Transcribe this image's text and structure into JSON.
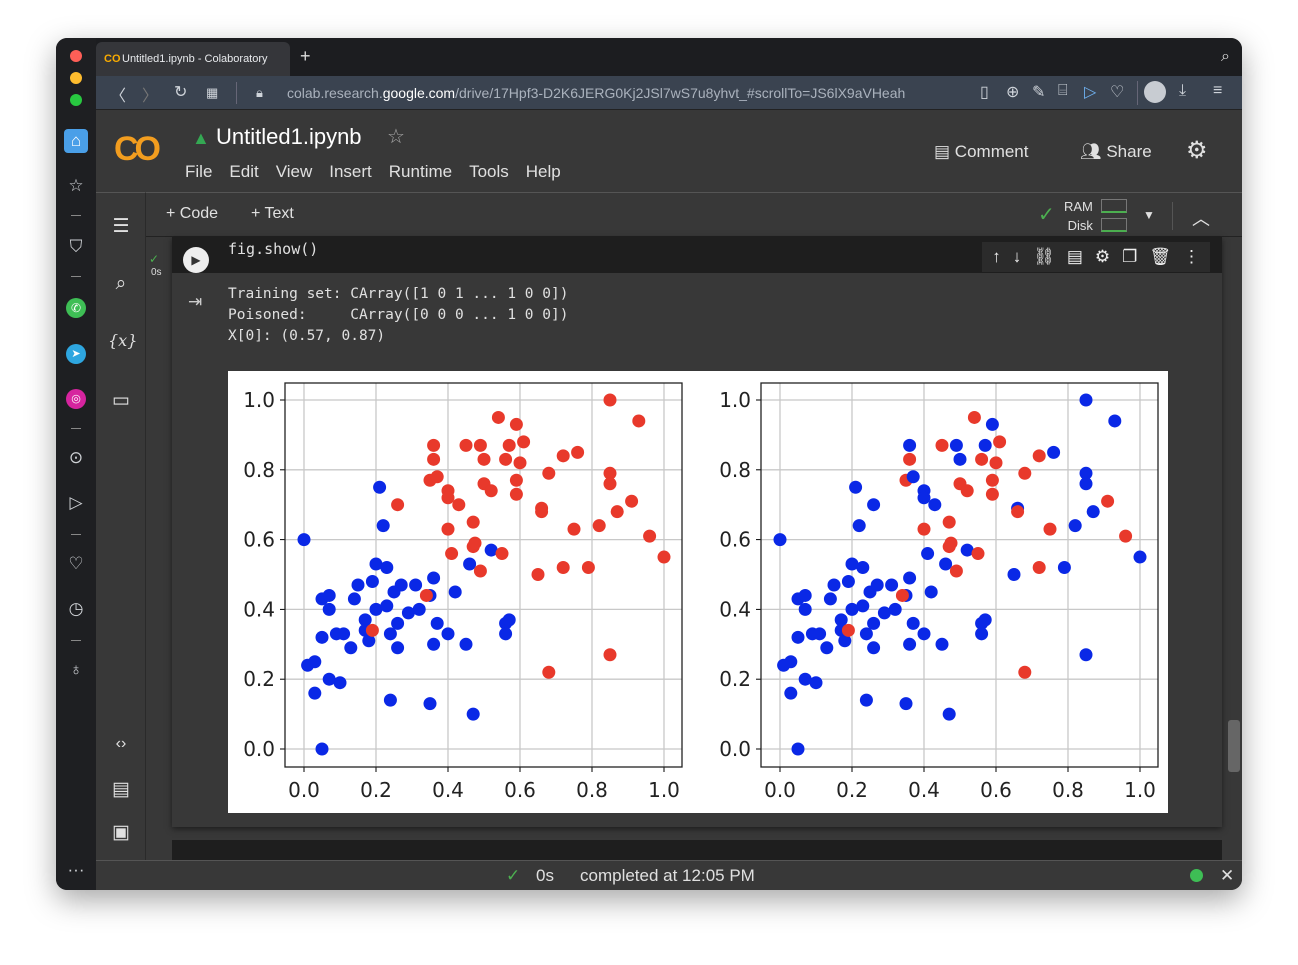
{
  "browser": {
    "tab_title": "Untitled1.ipynb - Colaboratory",
    "url_prefix": "colab.research.",
    "url_domain": "google.com",
    "url_path": "/drive/17Hpf3-D2K6JERG0Kj2JSl7wS7u8yhvt_#scrollTo=JS6lX9aVHeah",
    "new_tab": "+"
  },
  "colab": {
    "logo": "CO",
    "title": "Untitled1.ipynb",
    "menu": [
      "File",
      "Edit",
      "View",
      "Insert",
      "Runtime",
      "Tools",
      "Help"
    ],
    "comment": "Comment",
    "share": "Share",
    "add_code": "+ Code",
    "add_text": "+ Text",
    "ram": "RAM",
    "disk": "Disk"
  },
  "cell": {
    "code": "fig.show()",
    "exec_time": "0s",
    "output": [
      "Training set: CArray([1 0 1 ... 1 0 0])",
      "Poisoned:     CArray([0 0 0 ... 1 0 0])",
      "X[0]: (0.57, 0.87)"
    ]
  },
  "status": {
    "time": "0s",
    "message": "completed at 12:05 PM"
  },
  "colors": {
    "red": "#e8392b",
    "blue": "#0a28e6"
  },
  "chart_data": [
    {
      "type": "scatter",
      "title": "Training set",
      "xlim": [
        -0.05,
        1.05
      ],
      "ylim": [
        -0.07,
        1.07
      ],
      "xticks": [
        "0.0",
        "0.2",
        "0.4",
        "0.6",
        "0.8",
        "1.0"
      ],
      "yticks": [
        "0.0",
        "0.2",
        "0.4",
        "0.6",
        "0.8",
        "1.0"
      ],
      "grid": true,
      "label_key": 2
    },
    {
      "type": "scatter",
      "title": "Poisoned",
      "xlim": [
        -0.05,
        1.05
      ],
      "ylim": [
        -0.07,
        1.07
      ],
      "xticks": [
        "0.0",
        "0.2",
        "0.4",
        "0.6",
        "0.8",
        "1.0"
      ],
      "yticks": [
        "0.0",
        "0.2",
        "0.4",
        "0.6",
        "0.8",
        "1.0"
      ],
      "grid": true,
      "label_key": 3
    }
  ],
  "points_columns": [
    "x",
    "y",
    "train_label",
    "poisoned_label"
  ],
  "points": [
    [
      0,
      0.6,
      0,
      0
    ],
    [
      0.21,
      0.75,
      0,
      0
    ],
    [
      0.22,
      0.64,
      0,
      0
    ],
    [
      0.2,
      0.53,
      0,
      0
    ],
    [
      0.23,
      0.52,
      0,
      0
    ],
    [
      0.19,
      0.48,
      0,
      0
    ],
    [
      0.15,
      0.47,
      0,
      0
    ],
    [
      0.14,
      0.43,
      0,
      0
    ],
    [
      0.05,
      0.43,
      0,
      0
    ],
    [
      0.07,
      0.44,
      0,
      0
    ],
    [
      0.07,
      0.4,
      0,
      0
    ],
    [
      0.2,
      0.4,
      0,
      0
    ],
    [
      0.23,
      0.41,
      0,
      0
    ],
    [
      0.25,
      0.45,
      0,
      0
    ],
    [
      0.27,
      0.47,
      0,
      0
    ],
    [
      0.31,
      0.47,
      0,
      0
    ],
    [
      0.36,
      0.49,
      0,
      0
    ],
    [
      0.35,
      0.44,
      0,
      0
    ],
    [
      0.32,
      0.4,
      0,
      0
    ],
    [
      0.29,
      0.39,
      0,
      0
    ],
    [
      0.26,
      0.36,
      0,
      0
    ],
    [
      0.17,
      0.37,
      0,
      0
    ],
    [
      0.17,
      0.34,
      0,
      0
    ],
    [
      0.18,
      0.31,
      0,
      0
    ],
    [
      0.24,
      0.33,
      0,
      0
    ],
    [
      0.26,
      0.29,
      0,
      0
    ],
    [
      0.37,
      0.36,
      0,
      0
    ],
    [
      0.4,
      0.33,
      0,
      0
    ],
    [
      0.36,
      0.3,
      0,
      0
    ],
    [
      0.45,
      0.3,
      0,
      0
    ],
    [
      0.42,
      0.45,
      0,
      0
    ],
    [
      0.46,
      0.53,
      0,
      0
    ],
    [
      0.52,
      0.57,
      0,
      0
    ],
    [
      0.56,
      0.36,
      0,
      0
    ],
    [
      0.57,
      0.37,
      0,
      0
    ],
    [
      0.56,
      0.33,
      0,
      0
    ],
    [
      0.09,
      0.33,
      0,
      0
    ],
    [
      0.11,
      0.33,
      0,
      0
    ],
    [
      0.13,
      0.29,
      0,
      0
    ],
    [
      0.05,
      0.32,
      0,
      0
    ],
    [
      0.01,
      0.24,
      0,
      0
    ],
    [
      0.03,
      0.25,
      0,
      0
    ],
    [
      0.07,
      0.2,
      0,
      0
    ],
    [
      0.1,
      0.19,
      0,
      0
    ],
    [
      0.03,
      0.16,
      0,
      0
    ],
    [
      0.24,
      0.14,
      0,
      0
    ],
    [
      0.35,
      0.13,
      0,
      0
    ],
    [
      0.47,
      0.1,
      0,
      0
    ],
    [
      0.05,
      0.0,
      0,
      0
    ],
    [
      0.85,
      1.0,
      1,
      0
    ],
    [
      0.93,
      0.94,
      1,
      0
    ],
    [
      0.54,
      0.95,
      1,
      1
    ],
    [
      0.59,
      0.93,
      1,
      0
    ],
    [
      0.36,
      0.87,
      1,
      0
    ],
    [
      0.45,
      0.87,
      1,
      1
    ],
    [
      0.49,
      0.87,
      1,
      0
    ],
    [
      0.57,
      0.87,
      1,
      0
    ],
    [
      0.61,
      0.88,
      1,
      1
    ],
    [
      0.36,
      0.83,
      1,
      1
    ],
    [
      0.5,
      0.83,
      1,
      0
    ],
    [
      0.56,
      0.83,
      1,
      1
    ],
    [
      0.6,
      0.82,
      1,
      1
    ],
    [
      0.72,
      0.84,
      1,
      1
    ],
    [
      0.76,
      0.85,
      1,
      0
    ],
    [
      0.35,
      0.77,
      1,
      1
    ],
    [
      0.37,
      0.78,
      1,
      0
    ],
    [
      0.59,
      0.77,
      1,
      1
    ],
    [
      0.68,
      0.79,
      1,
      1
    ],
    [
      0.85,
      0.79,
      1,
      0
    ],
    [
      0.85,
      0.76,
      1,
      0
    ],
    [
      0.4,
      0.74,
      1,
      0
    ],
    [
      0.4,
      0.72,
      1,
      0
    ],
    [
      0.5,
      0.76,
      1,
      1
    ],
    [
      0.52,
      0.74,
      1,
      1
    ],
    [
      0.59,
      0.73,
      1,
      1
    ],
    [
      0.26,
      0.7,
      1,
      0
    ],
    [
      0.43,
      0.7,
      1,
      0
    ],
    [
      0.91,
      0.71,
      1,
      1
    ],
    [
      0.87,
      0.68,
      1,
      0
    ],
    [
      0.66,
      0.69,
      1,
      0
    ],
    [
      0.66,
      0.68,
      1,
      1
    ],
    [
      0.47,
      0.65,
      1,
      1
    ],
    [
      0.4,
      0.63,
      1,
      1
    ],
    [
      0.75,
      0.63,
      1,
      1
    ],
    [
      0.82,
      0.64,
      1,
      0
    ],
    [
      0.96,
      0.61,
      1,
      1
    ],
    [
      0.47,
      0.58,
      1,
      1
    ],
    [
      0.475,
      0.59,
      1,
      1
    ],
    [
      0.41,
      0.56,
      1,
      0
    ],
    [
      0.55,
      0.56,
      1,
      1
    ],
    [
      1.0,
      0.55,
      1,
      0
    ],
    [
      0.49,
      0.51,
      1,
      1
    ],
    [
      0.65,
      0.5,
      1,
      0
    ],
    [
      0.72,
      0.52,
      1,
      1
    ],
    [
      0.79,
      0.52,
      1,
      0
    ],
    [
      0.34,
      0.44,
      1,
      1
    ],
    [
      0.19,
      0.34,
      1,
      1
    ],
    [
      0.85,
      0.27,
      1,
      0
    ],
    [
      0.68,
      0.22,
      1,
      1
    ]
  ]
}
